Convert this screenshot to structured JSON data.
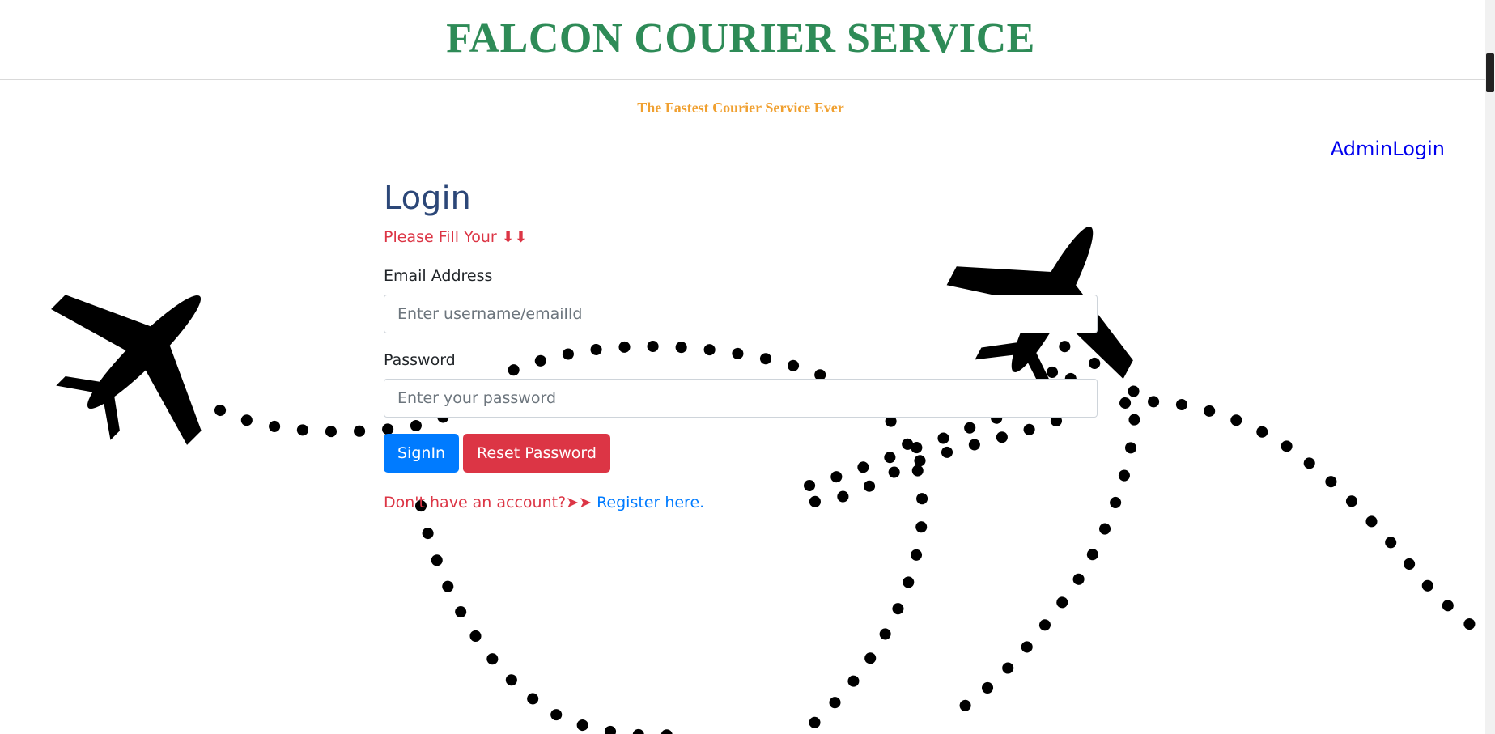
{
  "header": {
    "brand": "FALCON COURIER SERVICE"
  },
  "tagline": "The Fastest Courier Service Ever",
  "nav": {
    "admin_login": "AdminLogin"
  },
  "form": {
    "title": "Login",
    "hint": "Please Fill Your ⬇⬇",
    "email_label": "Email Address",
    "email_placeholder": "Enter username/emailId",
    "password_label": "Password",
    "password_placeholder": "Enter your password",
    "signin_label": "SignIn",
    "reset_label": "Reset Password",
    "register_prompt": "Don't have an account?➤➤ ",
    "register_link": "Register here."
  },
  "colors": {
    "brand": "#2e8b57",
    "tagline": "#f0a030",
    "title": "#2c4778",
    "primary": "#007bff",
    "danger": "#dc3545",
    "link": "#0000ee"
  },
  "icons": [
    "airplane-icon",
    "airplane-icon",
    "scroll-thumb"
  ]
}
